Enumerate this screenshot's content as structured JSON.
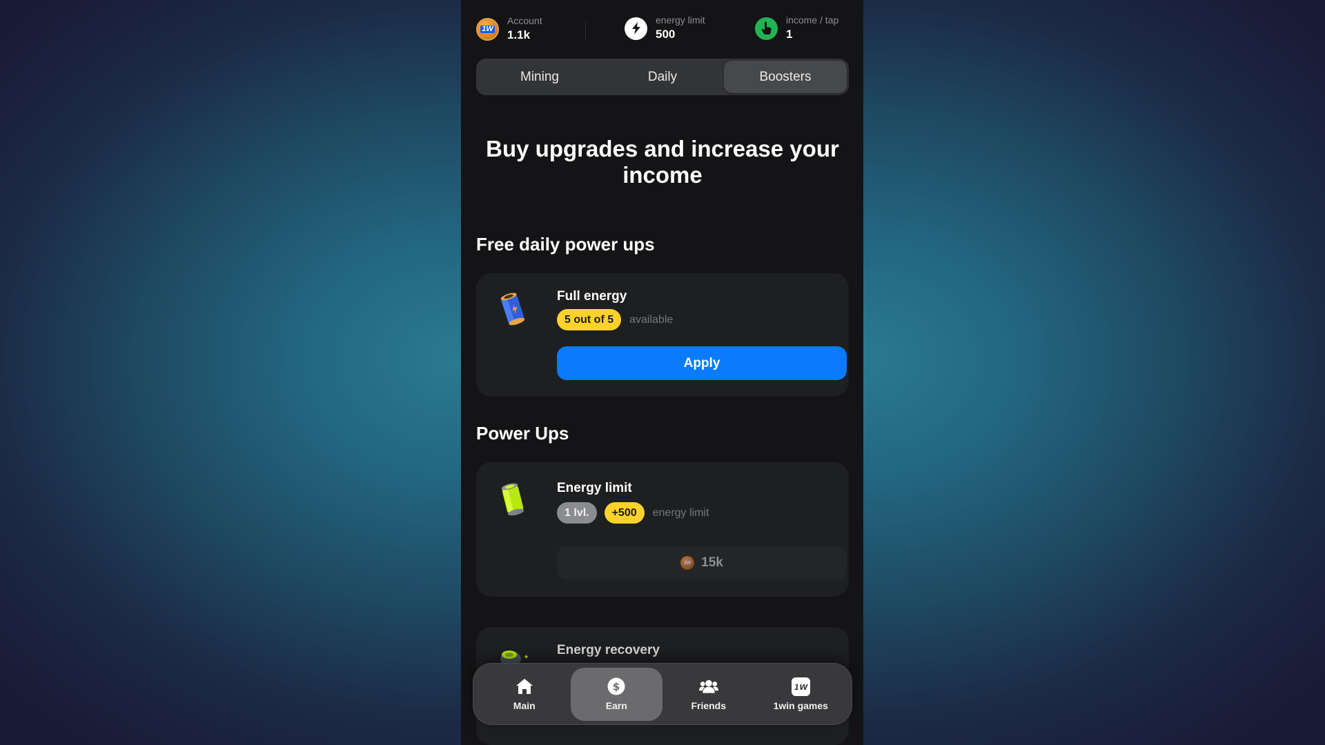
{
  "header": {
    "account": {
      "label": "Account",
      "value": "1.1k",
      "icon": "1w-coin-icon"
    },
    "energy_limit": {
      "label": "energy limit",
      "value": "500",
      "icon": "lightning-icon"
    },
    "income_per_tap": {
      "label": "income / tap",
      "value": "1",
      "icon": "tap-hand-icon"
    }
  },
  "tabs": [
    {
      "label": "Mining",
      "active": false
    },
    {
      "label": "Daily",
      "active": false
    },
    {
      "label": "Boosters",
      "active": true
    }
  ],
  "page_title": "Buy upgrades and increase your income",
  "free_section": {
    "heading": "Free daily power ups",
    "items": [
      {
        "name": "Full energy",
        "icon": "blue-battery-icon",
        "badge": "5 out of 5",
        "badge_suffix": "available",
        "action_label": "Apply"
      }
    ]
  },
  "powerups_section": {
    "heading": "Power Ups",
    "items": [
      {
        "name": "Energy limit",
        "icon": "green-battery-icon",
        "level": "1 lvl.",
        "bonus": "+500",
        "bonus_suffix": "energy limit",
        "price": "15k"
      },
      {
        "name": "Energy recovery",
        "icon": "energy-recovery-icon"
      }
    ]
  },
  "bottom_nav": [
    {
      "label": "Main",
      "icon": "home-icon",
      "active": false
    },
    {
      "label": "Earn",
      "icon": "dollar-coin-icon",
      "active": true
    },
    {
      "label": "Friends",
      "icon": "friends-icon",
      "active": false
    },
    {
      "label": "1win games",
      "icon": "1win-logo-icon",
      "active": false
    }
  ],
  "colors": {
    "accent_blue": "#0a7bfd",
    "badge_yellow": "#fdd22b",
    "income_green": "#21b455",
    "panel_bg": "#141416",
    "card_bg": "#1e1f21"
  }
}
